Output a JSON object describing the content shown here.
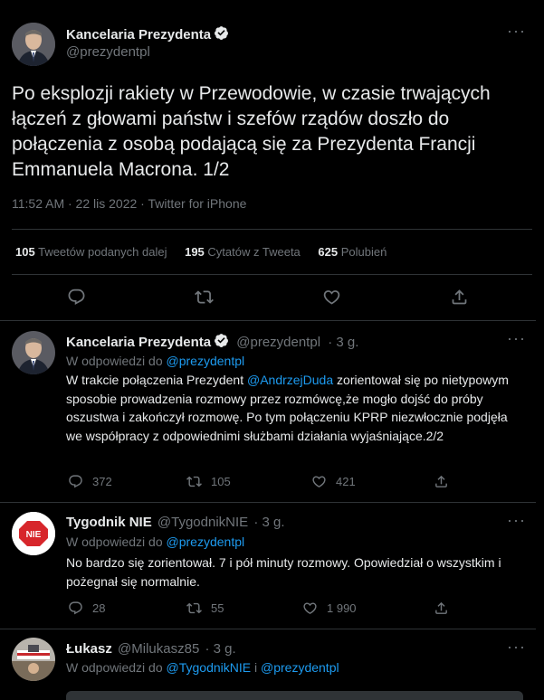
{
  "main_tweet": {
    "author_name": "Kancelaria Prezydenta",
    "handle": "@prezydentpl",
    "text": "Po eksplozji rakiety w Przewodowie, w czasie trwających łączeń z głowami państw i szefów rządów doszło do połączenia z osobą podającą się za Prezydenta Francji Emmanuela Macrona. 1/2",
    "meta": "11:52 AM · 22 lis 2022 · Twitter for iPhone",
    "stats": {
      "retweets_count": "105",
      "retweets_label": "Tweetów podanych dalej",
      "quotes_count": "195",
      "quotes_label": "Cytatów z Tweeta",
      "likes_count": "625",
      "likes_label": "Polubień"
    }
  },
  "replies": [
    {
      "author_name": "Kancelaria Prezydenta",
      "handle": "@prezydentpl",
      "time": "· 3 g.",
      "reply_prefix": "W odpowiedzi do",
      "reply_to": "@prezydentpl",
      "text_before": "W trakcie połączenia Prezydent ",
      "mention": "@AndrzejDuda",
      "text_after": " zorientował się po nietypowym sposobie prowadzenia rozmowy przez rozmówcę,że mogło dojść do próby oszustwa i zakończył rozmowę. Po tym połączeniu KPRP niezwłocznie podjęła we współpracy z odpowiednimi służbami działania wyjaśniające.2/2",
      "replies_count": "372",
      "retweets_count": "105",
      "likes_count": "421"
    },
    {
      "author_name": "Tygodnik NIE",
      "handle": "@TygodnikNIE",
      "time": "· 3 g.",
      "reply_prefix": "W odpowiedzi do",
      "reply_to": "@prezydentpl",
      "avatar_text": "NIE",
      "text": "No bardzo się zorientował. 7 i pół minuty rozmowy. Opowiedział o wszystkim i pożegnał się normalnie.",
      "replies_count": "28",
      "retweets_count": "55",
      "likes_count": "1 990"
    },
    {
      "author_name": "Łukasz",
      "handle": "@Milukasz85",
      "time": "· 3 g.",
      "reply_prefix": "W odpowiedzi do",
      "reply_to_1": "@TygodnikNIE",
      "reply_join": " i ",
      "reply_to_2": "@prezydentpl"
    }
  ],
  "icons": {
    "reply": "reply-icon",
    "retweet": "retweet-icon",
    "like": "like-icon",
    "share": "share-icon",
    "more": "more-icon",
    "verified": "verified-badge-icon"
  },
  "colors": {
    "background": "#000000",
    "text": "#e7e9ea",
    "muted": "#71767b",
    "accent": "#1d9bf0",
    "divider": "#2f3336"
  }
}
